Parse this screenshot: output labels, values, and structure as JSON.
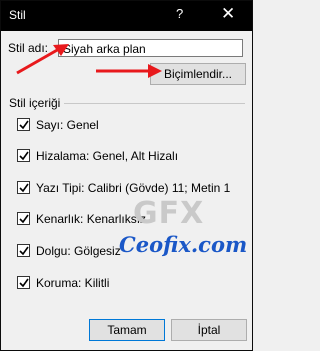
{
  "window": {
    "title": "Stil",
    "help_glyph": "?",
    "close_glyph": "✕"
  },
  "style_name": {
    "label": "Stil adı:",
    "value": "Siyah arka plan"
  },
  "format_button": "Biçimlendir...",
  "includes": {
    "title": "Stil içeriği",
    "items": [
      {
        "label": "Sayı: Genel",
        "checked": true
      },
      {
        "label": "Hizalama: Genel, Alt Hizalı",
        "checked": true
      },
      {
        "label": "Yazı Tipi: Calibri (Gövde) 11; Metin 1",
        "checked": true
      },
      {
        "label": "Kenarlık: Kenarlıksız",
        "checked": true
      },
      {
        "label": "Dolgu: Gölgesiz",
        "checked": true
      },
      {
        "label": "Koruma: Kilitli",
        "checked": true
      }
    ]
  },
  "buttons": {
    "ok": "Tamam",
    "cancel": "İptal"
  },
  "watermark": {
    "logo": "GFX",
    "site": "Ceofix.com"
  },
  "colors": {
    "titlebar": "#000000",
    "arrow": "#e8191c",
    "watermark_text": "#1a57c7",
    "default_border": "#0078d7"
  }
}
